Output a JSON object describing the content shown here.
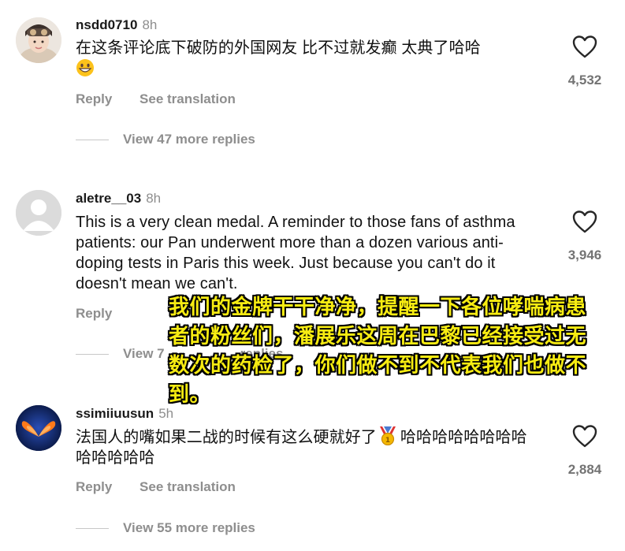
{
  "comments": [
    {
      "username": "nsdd0710",
      "time": "8h",
      "text": "在这条评论底下破防的外国网友 比不过就发癫 太典了哈哈",
      "emoji": "grinning-face",
      "like_count": "4,532",
      "reply_label": "Reply",
      "translate_label": "See translation",
      "view_replies": "View 47 more replies"
    },
    {
      "username": "aletre__03",
      "time": "8h",
      "text": "This is a very clean medal. A reminder to those fans of asthma patients: our Pan underwent more than a dozen various anti-doping tests in Paris this week. Just because you can't do it doesn't mean we can't.",
      "like_count": "3,946",
      "reply_label": "Reply",
      "view_replies_partial": "View 7",
      "view_replies_tail": "replies"
    },
    {
      "username": "ssimiiuusun",
      "time": "5h",
      "text_before": "法国人的嘴如果二战的时候有这么硬就好了",
      "emoji": "medal",
      "text_after": "哈哈哈哈哈哈哈哈哈哈哈哈哈",
      "like_count": "2,884",
      "reply_label": "Reply",
      "translate_label": "See translation",
      "view_replies": "View 55 more replies"
    }
  ],
  "overlay_caption": "我们的金牌干干净净，提醒一下各位哮喘病患者的粉丝们，潘展乐这周在巴黎已经接受过无数次的药检了，你们做不到不代表我们也做不到。",
  "icons": {
    "like": "heart-outline-icon"
  },
  "colors": {
    "meta_gray": "#8e8e8e",
    "caption_yellow": "#f7ec12"
  }
}
